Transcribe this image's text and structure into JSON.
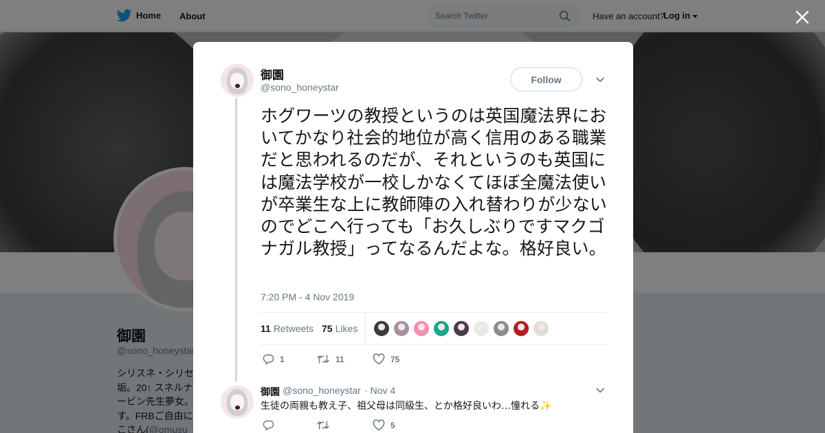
{
  "nav": {
    "home": "Home",
    "about": "About"
  },
  "search": {
    "placeholder": "Search Twitter"
  },
  "account": {
    "prompt": "Have an account?",
    "login": "Log in"
  },
  "profile": {
    "name": "御園",
    "handle": "@sono_honeystar",
    "bio_lines": [
      "シリスネ・シリセ",
      "垢。20↑ スネルナ",
      "ービン先生夢女。",
      "す。FRBご自由に",
      "こさん("
    ],
    "bio_mention": "@omusu_"
  },
  "tweet": {
    "author_name": "御園",
    "author_handle": "@sono_honeystar",
    "follow_label": "Follow",
    "text": "ホグワーツの教授というのは英国魔法界においてかなり社会的地位が高く信用のある職業だと思われるのだが、それというのも英国には魔法学校が一校しかなくてほぼ全魔法使いが卒業生な上に教師陣の入れ替わりが少ないのでどこへ行っても「お久しぶりですマクゴナガル教授」ってなるんだよな。格好良い。",
    "timestamp": "7:20 PM - 4 Nov 2019",
    "retweets_count": "11",
    "retweets_label": "Retweets",
    "likes_count": "75",
    "likes_label": "Likes",
    "liker_colors": [
      "#3b3b3b",
      "#a88fa0",
      "#f48fb1",
      "#1aa58c",
      "#4a3b4a",
      "#e8e8e8",
      "#8d8d8d",
      "#b71c1c",
      "#e0ddd3"
    ],
    "actions": {
      "reply": "1",
      "retweet": "11",
      "like": "75"
    }
  },
  "reply": {
    "author_name": "御園",
    "author_handle": "@sono_honeystar",
    "date_sep": "·",
    "date": "Nov 4",
    "text": "生徒の両親も教え子、祖父母は同級生、とか格好良いわ…憧れる",
    "emoji": "✨",
    "actions": {
      "reply": "",
      "retweet": "",
      "like": "5"
    }
  },
  "colors": {
    "accent": "#1da1f2",
    "muted": "#657786",
    "border": "#e6ecf0"
  }
}
